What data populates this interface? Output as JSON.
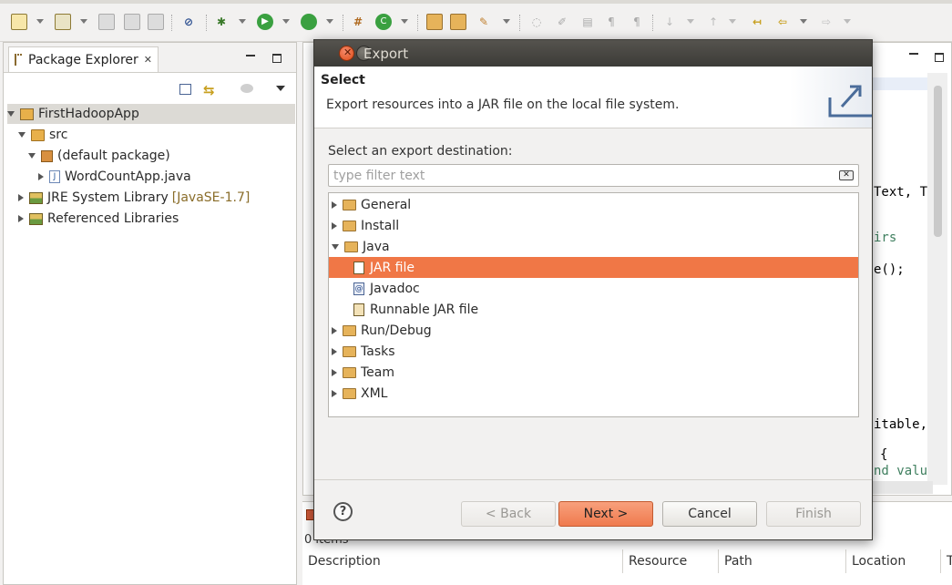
{
  "package_explorer": {
    "tab_label": "Package Explorer",
    "tab_close": "✕",
    "tree": [
      {
        "label": "FirstHadoopApp",
        "extra": ""
      },
      {
        "label": "src",
        "extra": ""
      },
      {
        "label": "(default package)",
        "extra": ""
      },
      {
        "label": "WordCountApp.java",
        "extra": ""
      },
      {
        "label": "JRE System Library",
        "extra": "[JavaSE-1.7]"
      },
      {
        "label": "Referenced Libraries",
        "extra": ""
      }
    ]
  },
  "editor": {
    "code_fragments": [
      "Text, Te",
      "irs",
      "e();",
      "itable,",
      "{",
      "nd value"
    ]
  },
  "problems": {
    "summary": "0 items",
    "columns": [
      "Description",
      "Resource",
      "Path",
      "Location",
      "T"
    ]
  },
  "dialog": {
    "title": "Export",
    "header_title": "Select",
    "header_description": "Export resources into a JAR file on the local file system.",
    "filter_label": "Select an export destination:",
    "filter_placeholder": "type filter text",
    "items": [
      {
        "label": "General"
      },
      {
        "label": "Install"
      },
      {
        "label": "Java"
      },
      {
        "label": "JAR file"
      },
      {
        "label": "Javadoc"
      },
      {
        "label": "Runnable JAR file"
      },
      {
        "label": "Run/Debug"
      },
      {
        "label": "Tasks"
      },
      {
        "label": "Team"
      },
      {
        "label": "XML"
      }
    ],
    "selected_item": "JAR file",
    "help_label": "?",
    "buttons": {
      "back": "< Back",
      "next": "Next >",
      "cancel": "Cancel",
      "finish": "Finish"
    }
  },
  "colors": {
    "selection": "#f07746",
    "titlebar": "#3c3b37",
    "primary_button": "#ef7a4e"
  }
}
